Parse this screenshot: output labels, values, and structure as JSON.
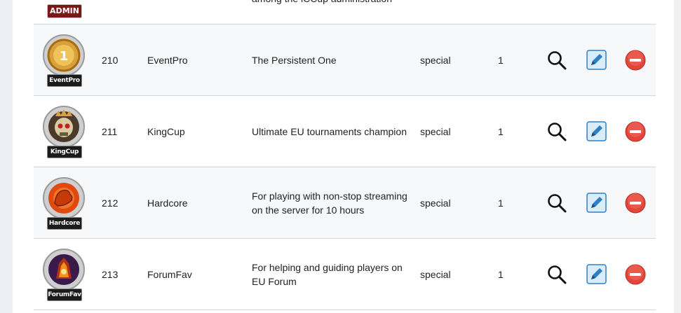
{
  "rows": [
    {
      "id": "",
      "name": "",
      "badge_label": "ADMIN",
      "description": "among the iCCup administration",
      "type": "",
      "count": ""
    },
    {
      "id": "210",
      "name": "EventPro",
      "badge_label": "EventPro",
      "description": "The Persistent One",
      "type": "special",
      "count": "1"
    },
    {
      "id": "211",
      "name": "KingCup",
      "badge_label": "KingCup",
      "description": "Ultimate EU tournaments champion",
      "type": "special",
      "count": "1"
    },
    {
      "id": "212",
      "name": "Hardcore",
      "badge_label": "Hardcore",
      "description": "For playing with non-stop streaming on the server for 10 hours",
      "type": "special",
      "count": "1"
    },
    {
      "id": "213",
      "name": "ForumFav",
      "badge_label": "ForumFav",
      "description": "For helping and guiding players on EU Forum",
      "type": "special",
      "count": "1"
    }
  ],
  "icons": {
    "view": "magnifier-icon",
    "edit": "pencil-icon",
    "delete": "minus-circle-icon"
  },
  "colors": {
    "accent_edit": "#2f7fc6",
    "delete_red": "#e2453a",
    "row_border": "#cfd6de"
  }
}
